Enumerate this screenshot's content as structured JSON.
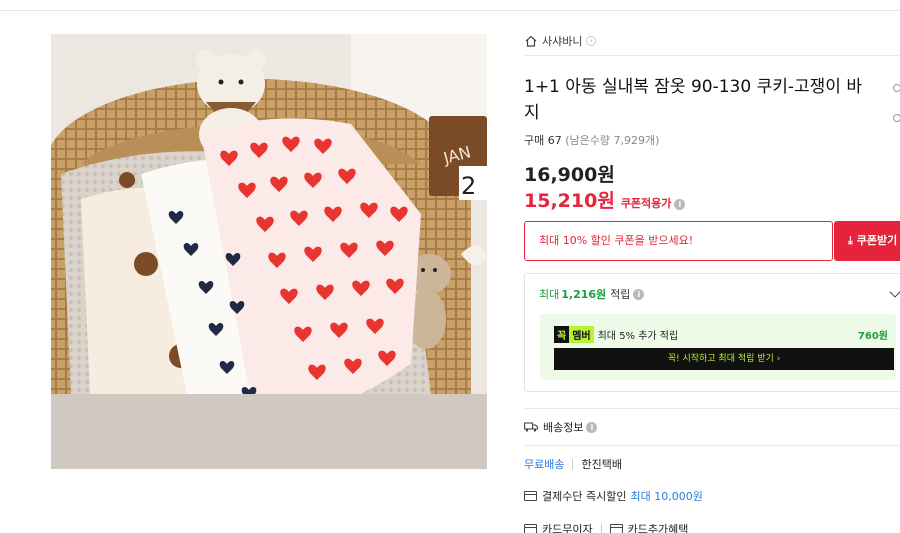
{
  "store": {
    "name": "사샤바니",
    "chevron": "›"
  },
  "product": {
    "title": "1+1 아동 실내복 잠옷 90-130 쿠키-고쟁이 바지",
    "purchase_label": "구매 67",
    "remaining": "(남은수량 7,929개)",
    "original_price": "16,900원",
    "sale_price": "15,210원",
    "coupon_applied": "쿠폰적용가"
  },
  "coupon": {
    "message": "최대 10% 할인 쿠폰을 받으세요!",
    "button": "쿠폰받기"
  },
  "reward": {
    "prefix": "최대",
    "amount": "1,216원",
    "suffix": "적립",
    "member_badge_a": "꼭",
    "member_badge_b": "멤버",
    "member_text": "최대 5% 추가 적립",
    "member_points": "760원",
    "cta": "꼭! 시작하고 최대 적립 받기 ›"
  },
  "shipping": {
    "title": "배송정보",
    "free": "무료배송",
    "courier": "한진택배"
  },
  "payment": {
    "label": "결제수단 즉시할인",
    "max": "최대 10,000원"
  },
  "cards": {
    "interest_free": "카드무이자",
    "extra": "카드추가혜택"
  },
  "icons": {
    "home": "home-icon",
    "info": "info-icon",
    "download": "download-icon",
    "truck": "truck-icon",
    "card": "card-icon"
  },
  "colors": {
    "accent_red": "#e5233a",
    "reward_green": "#1f9d3e",
    "link_blue": "#2b7bd6",
    "member_lime": "#b8f235"
  }
}
